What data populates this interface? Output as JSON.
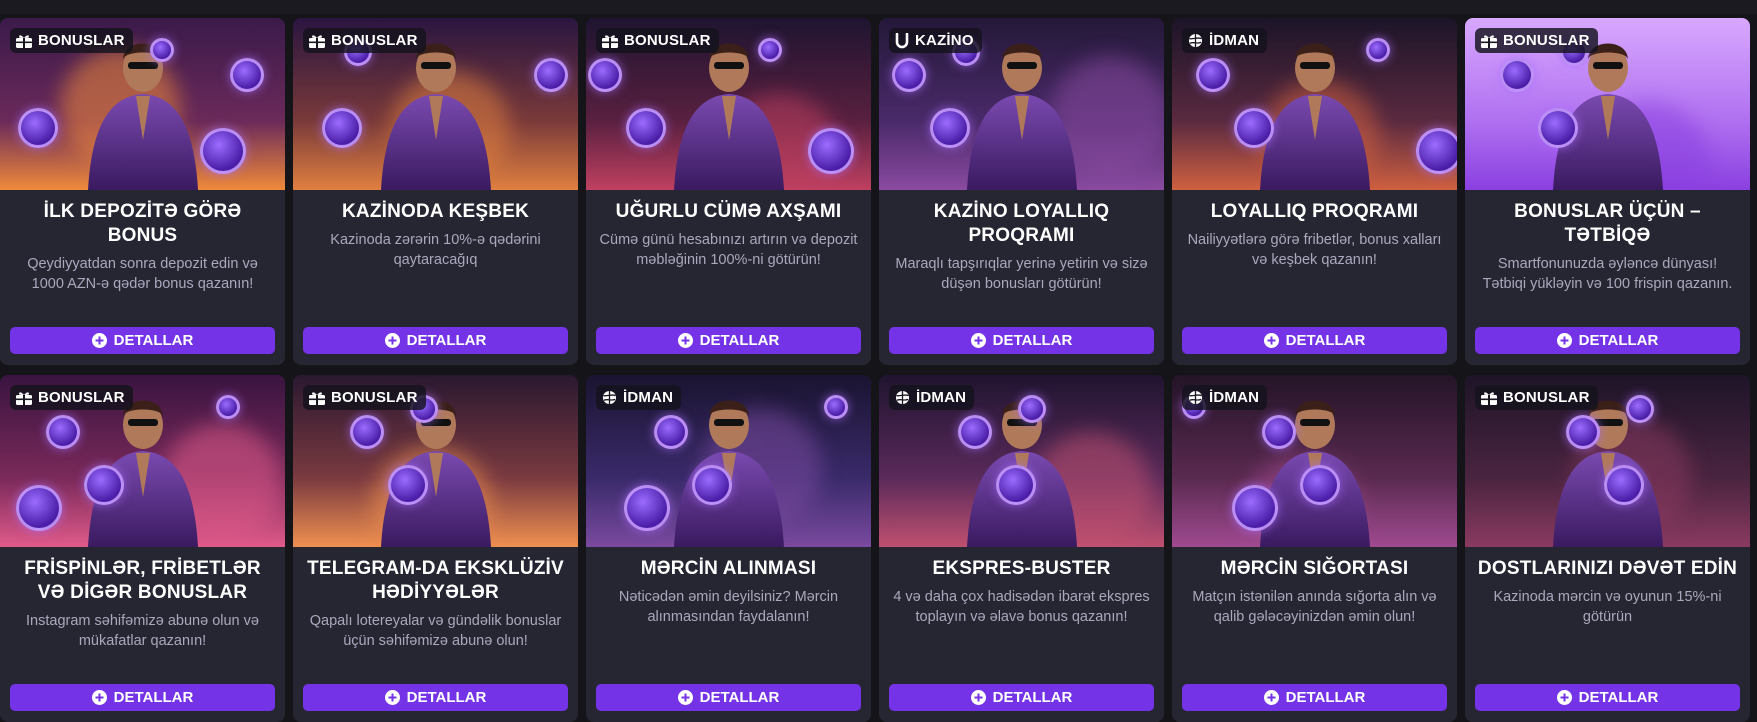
{
  "cards": [
    {
      "tag": "BONUSLAR",
      "tag_icon": "gift-icon",
      "title": "İLK DEPOZİTƏ GÖRƏ BONUS",
      "desc": "Qeydiyyatdan sonra depozit edin və 1000 AZN-ə qədər bonus qazanın!",
      "button": "DETALLAR",
      "bg": [
        "#3a1a4a",
        "#6b2a5a",
        "#f08a3a"
      ]
    },
    {
      "tag": "BONUSLAR",
      "tag_icon": "gift-icon",
      "title": "KAZİNODA KEŞBEK",
      "desc": "Kazinoda zərərin 10%-ə qədərini qaytaracağıq",
      "button": "DETALLAR",
      "bg": [
        "#2a1540",
        "#7a3a3a",
        "#e08040"
      ]
    },
    {
      "tag": "BONUSLAR",
      "tag_icon": "gift-icon",
      "title": "UĞURLU CÜMƏ AXŞAMI",
      "desc": "Cümə günü hesabınızı artırın və depozit məbləğinin 100%-ni götürün!",
      "button": "DETALLAR",
      "bg": [
        "#1e1430",
        "#5a2040",
        "#c04060"
      ]
    },
    {
      "tag": "KAZİNO",
      "tag_icon": "horseshoe-icon",
      "title": "KAZİNO LOYALLIQ PROQRAMI",
      "desc": "Maraqlı tapşırıqlar yerinə yetirin və sizə düşən bonusları götürün!",
      "button": "DETALLAR",
      "bg": [
        "#241838",
        "#4a2a6a",
        "#8a4aa0"
      ]
    },
    {
      "tag": "İDMAN",
      "tag_icon": "ball-icon",
      "title": "LOYALLIQ PROQRAMI",
      "desc": "Nailiyyətlərə görə fribetlər, bonus xalları və keşbek qazanın!",
      "button": "DETALLAR",
      "bg": [
        "#1c1428",
        "#5a2a40",
        "#d06040"
      ]
    },
    {
      "tag": "BONUSLAR",
      "tag_icon": "gift-icon",
      "title": "BONUSLAR ÜÇÜN – TƏTBİQƏ",
      "desc": "Smartfonunuzda əyləncə dünyası! Tətbiqi yükləyin və 100 frispin qazanın.",
      "button": "DETALLAR",
      "bg": [
        "#d8a8ff",
        "#b070f0",
        "#8a40e0"
      ]
    },
    {
      "tag": "BONUSLAR",
      "tag_icon": "gift-icon",
      "title": "FRİSPİNLƏR, FRİBETLƏR VƏ DİGƏR BONUSLAR",
      "desc": "Instagram səhifəmizə abunə olun və mükafatlar qazanın!",
      "button": "DETALLAR",
      "bg": [
        "#3a1440",
        "#7a2a5a",
        "#e05a8a"
      ]
    },
    {
      "tag": "BONUSLAR",
      "tag_icon": "gift-icon",
      "title": "TELEGRAM-DA EKSKLÜZİV HƏDİYYƏLƏR",
      "desc": "Qapalı lotereyalar və gündəlik bonuslar üçün səhifəmizə abunə olun!",
      "button": "DETALLAR",
      "bg": [
        "#2a1830",
        "#7a3a40",
        "#f09050"
      ]
    },
    {
      "tag": "İDMAN",
      "tag_icon": "ball-icon",
      "title": "MƏRCİN ALINMASI",
      "desc": "Nəticədən əmin deyilsiniz? Mərcin alınmasından faydalanın!",
      "button": "DETALLAR",
      "bg": [
        "#1a1430",
        "#3a2a6a",
        "#7a4aa0"
      ]
    },
    {
      "tag": "İDMAN",
      "tag_icon": "ball-icon",
      "title": "EKSPRES-BUSTER",
      "desc": "4 və daha çox hadisədən ibarət ekspres toplayın və əlavə bonus qazanın!",
      "button": "DETALLAR",
      "bg": [
        "#201430",
        "#5a2a5a",
        "#c05070"
      ]
    },
    {
      "tag": "İDMAN",
      "tag_icon": "ball-icon",
      "title": "MƏRCİN SIĞORTASI",
      "desc": "Matçın istənilən anında sığorta alın və qalib gələcəyinizdən əmin olun!",
      "button": "DETALLAR",
      "bg": [
        "#241428",
        "#5a2a50",
        "#a04a90"
      ]
    },
    {
      "tag": "BONUSLAR",
      "tag_icon": "gift-icon",
      "title": "DOSTLARINIZI DƏVƏT EDİN",
      "desc": "Kazinoda mərcin və oyunun 15%-ni götürün",
      "button": "DETALLAR",
      "bg": [
        "#1e1428",
        "#4a2440",
        "#8a3a60"
      ]
    }
  ]
}
